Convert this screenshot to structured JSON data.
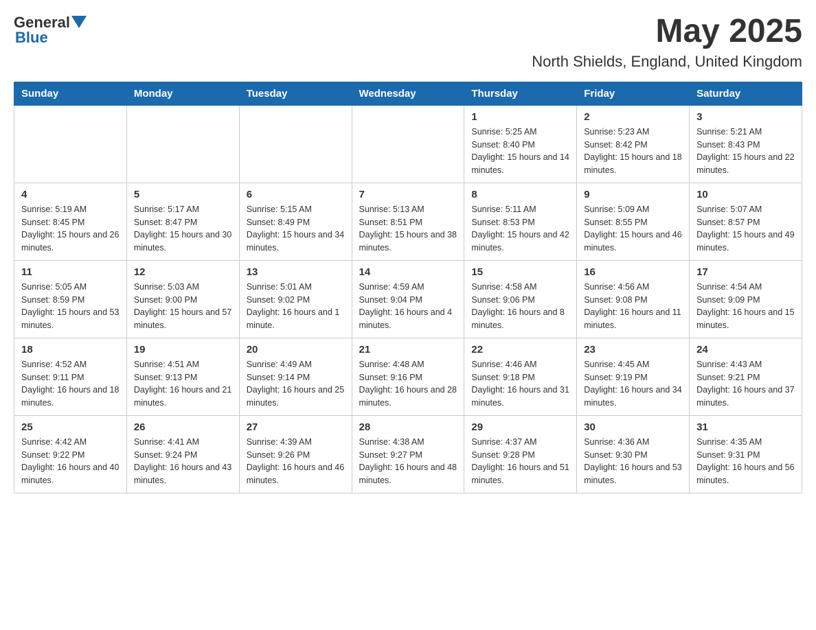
{
  "header": {
    "logo": {
      "general": "General",
      "blue": "Blue"
    },
    "title": "May 2025",
    "subtitle": "North Shields, England, United Kingdom"
  },
  "calendar": {
    "headers": [
      "Sunday",
      "Monday",
      "Tuesday",
      "Wednesday",
      "Thursday",
      "Friday",
      "Saturday"
    ],
    "weeks": [
      [
        {
          "day": "",
          "info": ""
        },
        {
          "day": "",
          "info": ""
        },
        {
          "day": "",
          "info": ""
        },
        {
          "day": "",
          "info": ""
        },
        {
          "day": "1",
          "info": "Sunrise: 5:25 AM\nSunset: 8:40 PM\nDaylight: 15 hours and 14 minutes."
        },
        {
          "day": "2",
          "info": "Sunrise: 5:23 AM\nSunset: 8:42 PM\nDaylight: 15 hours and 18 minutes."
        },
        {
          "day": "3",
          "info": "Sunrise: 5:21 AM\nSunset: 8:43 PM\nDaylight: 15 hours and 22 minutes."
        }
      ],
      [
        {
          "day": "4",
          "info": "Sunrise: 5:19 AM\nSunset: 8:45 PM\nDaylight: 15 hours and 26 minutes."
        },
        {
          "day": "5",
          "info": "Sunrise: 5:17 AM\nSunset: 8:47 PM\nDaylight: 15 hours and 30 minutes."
        },
        {
          "day": "6",
          "info": "Sunrise: 5:15 AM\nSunset: 8:49 PM\nDaylight: 15 hours and 34 minutes."
        },
        {
          "day": "7",
          "info": "Sunrise: 5:13 AM\nSunset: 8:51 PM\nDaylight: 15 hours and 38 minutes."
        },
        {
          "day": "8",
          "info": "Sunrise: 5:11 AM\nSunset: 8:53 PM\nDaylight: 15 hours and 42 minutes."
        },
        {
          "day": "9",
          "info": "Sunrise: 5:09 AM\nSunset: 8:55 PM\nDaylight: 15 hours and 46 minutes."
        },
        {
          "day": "10",
          "info": "Sunrise: 5:07 AM\nSunset: 8:57 PM\nDaylight: 15 hours and 49 minutes."
        }
      ],
      [
        {
          "day": "11",
          "info": "Sunrise: 5:05 AM\nSunset: 8:59 PM\nDaylight: 15 hours and 53 minutes."
        },
        {
          "day": "12",
          "info": "Sunrise: 5:03 AM\nSunset: 9:00 PM\nDaylight: 15 hours and 57 minutes."
        },
        {
          "day": "13",
          "info": "Sunrise: 5:01 AM\nSunset: 9:02 PM\nDaylight: 16 hours and 1 minute."
        },
        {
          "day": "14",
          "info": "Sunrise: 4:59 AM\nSunset: 9:04 PM\nDaylight: 16 hours and 4 minutes."
        },
        {
          "day": "15",
          "info": "Sunrise: 4:58 AM\nSunset: 9:06 PM\nDaylight: 16 hours and 8 minutes."
        },
        {
          "day": "16",
          "info": "Sunrise: 4:56 AM\nSunset: 9:08 PM\nDaylight: 16 hours and 11 minutes."
        },
        {
          "day": "17",
          "info": "Sunrise: 4:54 AM\nSunset: 9:09 PM\nDaylight: 16 hours and 15 minutes."
        }
      ],
      [
        {
          "day": "18",
          "info": "Sunrise: 4:52 AM\nSunset: 9:11 PM\nDaylight: 16 hours and 18 minutes."
        },
        {
          "day": "19",
          "info": "Sunrise: 4:51 AM\nSunset: 9:13 PM\nDaylight: 16 hours and 21 minutes."
        },
        {
          "day": "20",
          "info": "Sunrise: 4:49 AM\nSunset: 9:14 PM\nDaylight: 16 hours and 25 minutes."
        },
        {
          "day": "21",
          "info": "Sunrise: 4:48 AM\nSunset: 9:16 PM\nDaylight: 16 hours and 28 minutes."
        },
        {
          "day": "22",
          "info": "Sunrise: 4:46 AM\nSunset: 9:18 PM\nDaylight: 16 hours and 31 minutes."
        },
        {
          "day": "23",
          "info": "Sunrise: 4:45 AM\nSunset: 9:19 PM\nDaylight: 16 hours and 34 minutes."
        },
        {
          "day": "24",
          "info": "Sunrise: 4:43 AM\nSunset: 9:21 PM\nDaylight: 16 hours and 37 minutes."
        }
      ],
      [
        {
          "day": "25",
          "info": "Sunrise: 4:42 AM\nSunset: 9:22 PM\nDaylight: 16 hours and 40 minutes."
        },
        {
          "day": "26",
          "info": "Sunrise: 4:41 AM\nSunset: 9:24 PM\nDaylight: 16 hours and 43 minutes."
        },
        {
          "day": "27",
          "info": "Sunrise: 4:39 AM\nSunset: 9:26 PM\nDaylight: 16 hours and 46 minutes."
        },
        {
          "day": "28",
          "info": "Sunrise: 4:38 AM\nSunset: 9:27 PM\nDaylight: 16 hours and 48 minutes."
        },
        {
          "day": "29",
          "info": "Sunrise: 4:37 AM\nSunset: 9:28 PM\nDaylight: 16 hours and 51 minutes."
        },
        {
          "day": "30",
          "info": "Sunrise: 4:36 AM\nSunset: 9:30 PM\nDaylight: 16 hours and 53 minutes."
        },
        {
          "day": "31",
          "info": "Sunrise: 4:35 AM\nSunset: 9:31 PM\nDaylight: 16 hours and 56 minutes."
        }
      ]
    ]
  }
}
